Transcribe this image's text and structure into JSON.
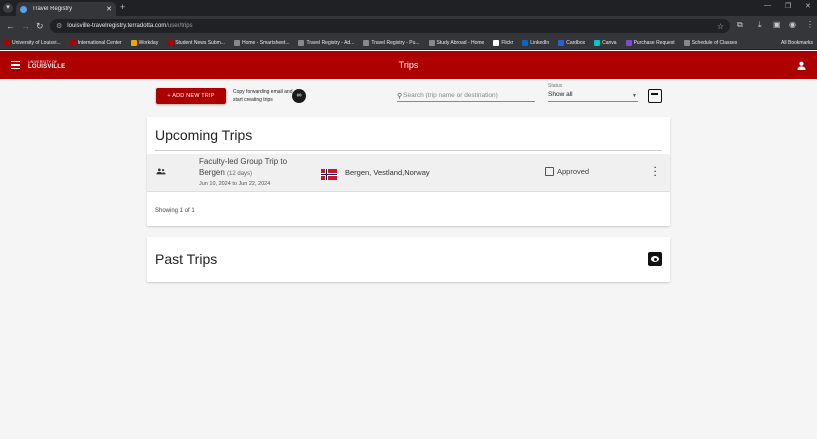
{
  "browser": {
    "tab_title": "Travel Registry",
    "url_host": "louisville-travelregistry.terradotta.com",
    "url_path": "/user/trips",
    "bookmarks": [
      {
        "label": "University of Louisvi...",
        "color": "#ad0000"
      },
      {
        "label": "International Center",
        "color": "#ad0000"
      },
      {
        "label": "Workday",
        "color": "#f0a500"
      },
      {
        "label": "Student News Subm...",
        "color": "#ad0000"
      },
      {
        "label": "Home - Smartsheet...",
        "color": "#888888"
      },
      {
        "label": "Travel Registry - Ad...",
        "color": "#888888"
      },
      {
        "label": "Travel Registry - Pu...",
        "color": "#888888"
      },
      {
        "label": "Study Abroad - Home",
        "color": "#888888"
      },
      {
        "label": "Flickr",
        "color": "#ffffff"
      },
      {
        "label": "LinkedIn",
        "color": "#0a66c2"
      },
      {
        "label": "Cardbox",
        "color": "#2b5fd9"
      },
      {
        "label": "Canva",
        "color": "#00c4cc"
      },
      {
        "label": "Purchase Request",
        "color": "#7b4cd0"
      },
      {
        "label": "Schedule of Classes",
        "color": "#888888"
      }
    ],
    "all_bookmarks": "All Bookmarks"
  },
  "appbar": {
    "title": "Trips",
    "logo_top": "UNIVERSITY OF",
    "logo_main": "LOUISVILLE"
  },
  "toolbar": {
    "add_trip_label": "+ ADD NEW TRIP",
    "copy_text": "Copy forwarding email and start creating trips",
    "search_placeholder": "Search (trip name or destination)",
    "status_label": "Status",
    "status_value": "Show all"
  },
  "upcoming": {
    "heading": "Upcoming Trips",
    "trip": {
      "name": "Faculty-led Group Trip to Bergen",
      "duration": "(12 days)",
      "dates": "Jun 10, 2024 to Jun 22, 2024",
      "destination": "Bergen, Vestland,Norway",
      "status": "Approved"
    },
    "showing": "Showing 1 of 1"
  },
  "past": {
    "heading": "Past Trips"
  },
  "colors": {
    "brand_red": "#ad0000"
  }
}
